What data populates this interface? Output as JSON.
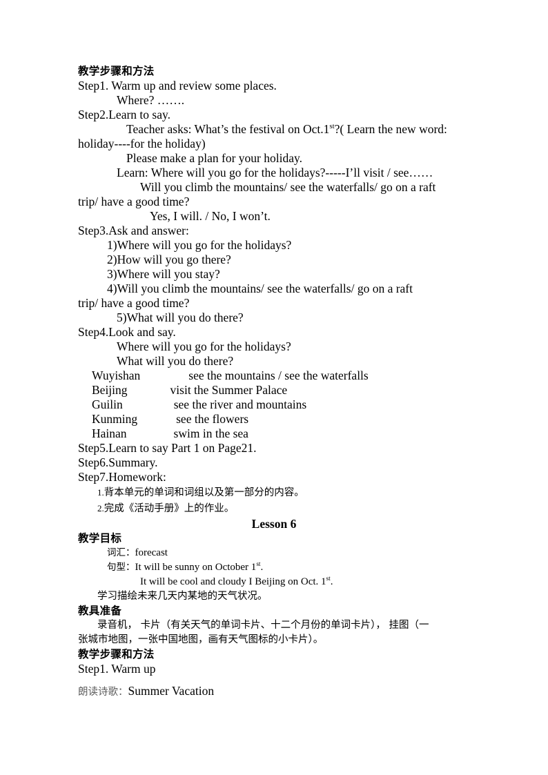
{
  "document": {
    "lesson5": {
      "heading_methods": "教学步骤和方法",
      "lines": [
        "Step1. Warm up and review some places.",
        "Where? …….",
        "Step2.Learn to say.",
        "Teacher asks: What’s the festival on Oct.1",
        "?( Learn the new word: holiday----for the holiday)",
        "Please make a plan for your holiday.",
        "Learn: Where will you go for the holidays?-----I’ll visit / see……",
        "Will you climb the mountains/ see the waterfalls/ go on a raft trip/ have a good time?",
        "Yes, I will. / No, I won’t.",
        "Step3.Ask and answer:"
      ],
      "step1_label": "Step1. Warm up and review some places.",
      "step1_sub": "Where? …….",
      "step2_label": "Step2.Learn to say.",
      "step2_teacher_pre": "Teacher asks: What’s the festival on Oct.1",
      "step2_teacher_sup": "st",
      "step2_teacher_post": "?( Learn the new word:",
      "step2_holiday": "holiday----for the holiday)",
      "step2_plan": "Please make a plan for your holiday.",
      "step2_learn": "Learn: Where will you go for the holidays?-----I’ll visit / see……",
      "step2_will": "Will you climb the mountains/ see the waterfalls/ go on a raft",
      "step2_trip": "trip/ have a good time?",
      "step2_yes": "Yes, I will. / No, I won’t.",
      "step3_label": "Step3.Ask and answer:",
      "step3_items": [
        "1)Where will you go for the holidays?",
        "2)How will you go there?",
        "3)Where will you stay?"
      ],
      "step3_item4a": "4)Will you climb the mountains/ see the waterfalls/ go on a raft",
      "step3_item4b": "trip/ have a good time?",
      "step3_item5": "5)What will you do there?",
      "step4_label": "Step4.Look and say.",
      "step4_q1": "Where will you go for the holidays?",
      "step4_q2": "What will you do there?",
      "places": [
        {
          "place": "Wuyishan",
          "activity": "see the mountains / see the waterfalls",
          "gap": 70
        },
        {
          "place": "Beijing",
          "activity": "visit the Summer Palace",
          "gap": 62
        },
        {
          "place": "Guilin",
          "activity": "see the river and mountains",
          "gap": 74
        },
        {
          "place": "Kunming",
          "activity": "see the flowers",
          "gap": 56
        },
        {
          "place": "Hainan",
          "activity": "swim in the sea",
          "gap": 68
        }
      ],
      "step5_label": "Step5.Learn to say Part 1 on Page21.",
      "step6_label": "Step6.Summary.",
      "step7_label": "Step7.Homework:",
      "homework": [
        {
          "num": "1.",
          "text": "背本单元的单词和词组以及第一部分的内容。"
        },
        {
          "num": "2.",
          "text": "完成《活动手册》上的作业。"
        }
      ]
    },
    "lesson6": {
      "title": "Lesson 6",
      "heading_objectives": "教学目标",
      "vocab_label": "词汇：",
      "vocab_value": "forecast",
      "pattern_label": "句型：",
      "pattern1_pre": "It will be sunny on October 1",
      "pattern1_sup": "st",
      "pattern1_post": ".",
      "pattern2_pre": "It will be cool and cloudy I Beijing on Oct. 1",
      "pattern2_sup": "st",
      "pattern2_post": ".",
      "objective_cn": "学习描绘未来几天内某地的天气状况。",
      "heading_materials": "教具准备",
      "materials_line1": "录音机， 卡片（有关天气的单词卡片、十二个月份的单词卡片）， 挂图（一",
      "materials_line2": "张城市地图，一张中国地图，画有天气图标的小卡片）。",
      "heading_methods": "教学步骤和方法",
      "step1_label": "Step1. Warm up",
      "poem_label": "朗读诗歌：",
      "poem_title": "Summer Vacation"
    }
  }
}
